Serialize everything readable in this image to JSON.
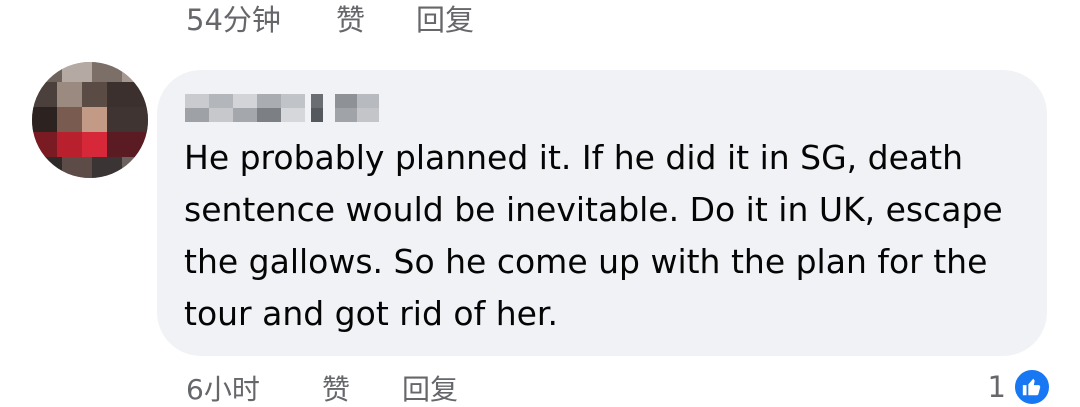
{
  "previous_comment": {
    "time": "54分钟",
    "like_label": "赞",
    "reply_label": "回复"
  },
  "comment": {
    "text": "He probably planned it. If he did it in SG, death sentence would be inevitable. Do it in UK, escape the gallows. So he come up with the plan for the tour and got rid of her.",
    "time": "6小时",
    "like_label": "赞",
    "reply_label": "回复",
    "reaction_count": "1",
    "reaction_icon": "like-thumb-icon"
  },
  "colors": {
    "bubble_bg": "#f0f2f5",
    "meta_text": "#65676b",
    "body_text": "#050505",
    "like_blue": "#1877f2"
  }
}
